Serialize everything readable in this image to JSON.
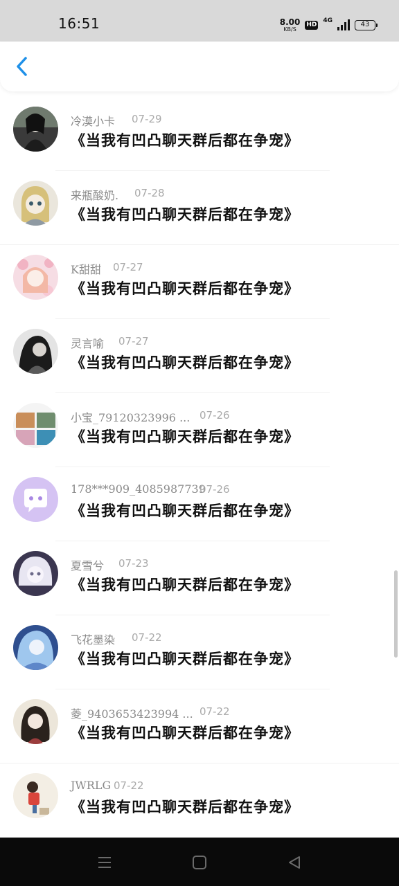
{
  "status_bar": {
    "time": "16:51",
    "speed_value": "8.00",
    "speed_unit": "KB/S",
    "hd": "HD",
    "network": "4G",
    "battery": "43"
  },
  "header": {
    "back_icon": "chevron-left-icon",
    "accent": "#1e90e8"
  },
  "comments": [
    {
      "name": "冷漠小卡",
      "date": "07-29",
      "text": "《当我有凹凸聊天群后都在争宠》"
    },
    {
      "name": "来瓶酸奶.",
      "date": "07-28",
      "text": "《当我有凹凸聊天群后都在争宠》"
    },
    {
      "name": "K甜甜",
      "date": "07-27",
      "text": "《当我有凹凸聊天群后都在争宠》"
    },
    {
      "name": "灵言喻",
      "date": "07-27",
      "text": "《当我有凹凸聊天群后都在争宠》"
    },
    {
      "name": "小宝_79120323996 ...",
      "date": "07-26",
      "text": "《当我有凹凸聊天群后都在争宠》"
    },
    {
      "name": "178***909_4085987739",
      "date": "07-26",
      "text": "《当我有凹凸聊天群后都在争宠》"
    },
    {
      "name": "夏雪兮",
      "date": "07-23",
      "text": "《当我有凹凸聊天群后都在争宠》"
    },
    {
      "name": "飞花墨染",
      "date": "07-22",
      "text": "《当我有凹凸聊天群后都在争宠》"
    },
    {
      "name": "菱_9403653423994 ...",
      "date": "07-22",
      "text": "《当我有凹凸聊天群后都在争宠》"
    },
    {
      "name": "JWRLG",
      "date": "07-22",
      "text": "《当我有凹凸聊天群后都在争宠》"
    }
  ],
  "nav_bar": {
    "menu_icon": "menu-icon",
    "home_icon": "home-square-icon",
    "back_icon": "back-triangle-icon"
  }
}
